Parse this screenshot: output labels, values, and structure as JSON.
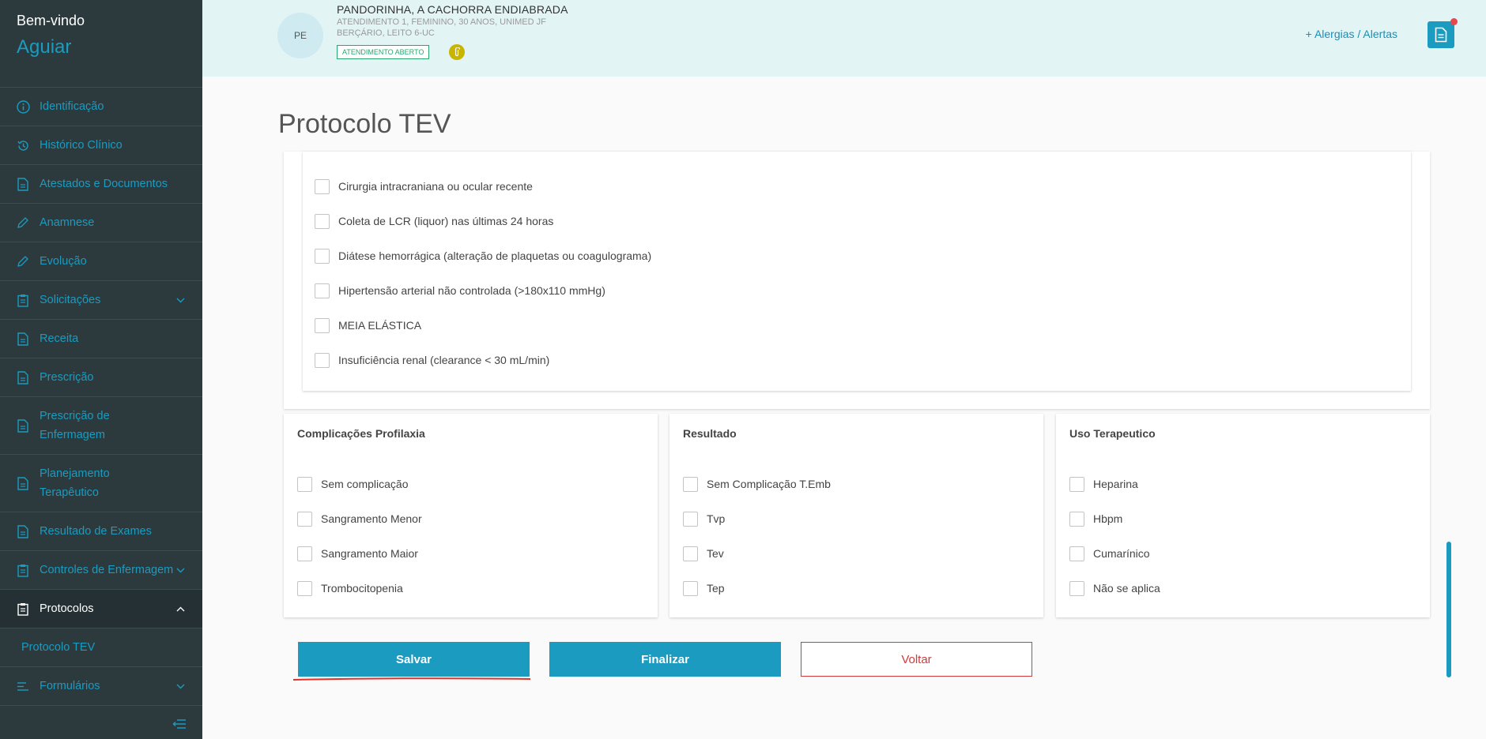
{
  "sidebar": {
    "welcome": "Bem-vindo",
    "user": "Aguiar",
    "items": [
      {
        "label": "Identificação",
        "icon": "info-icon"
      },
      {
        "label": "Histórico Clínico",
        "icon": "history-icon"
      },
      {
        "label": "Atestados e Documentos",
        "icon": "document-icon"
      },
      {
        "label": "Anamnese",
        "icon": "pencil-icon"
      },
      {
        "label": "Evolução",
        "icon": "pencil-icon"
      },
      {
        "label": "Solicitações",
        "icon": "clipboard-icon"
      },
      {
        "label": "Receita",
        "icon": "document-icon"
      },
      {
        "label": "Prescrição",
        "icon": "document-icon"
      },
      {
        "label": "Prescrição de Enfermagem",
        "icon": "document-icon"
      },
      {
        "label": "Planejamento Terapêutico",
        "icon": "document-icon"
      },
      {
        "label": "Resultado de Exames",
        "icon": "document-icon"
      },
      {
        "label": "Controles de Enfermagem",
        "icon": "clipboard-icon"
      },
      {
        "label": "Protocolos",
        "icon": "clipboard-icon"
      },
      {
        "label": "Formulários",
        "icon": "list-icon"
      }
    ],
    "subitem": "Protocolo TEV"
  },
  "header": {
    "initials": "PE",
    "patient_name": "PANDORINHA, A CACHORRA ENDIABRADA",
    "line1": "ATENDIMENTO 1, FEMININO, 30 ANOS, UNIMED JF",
    "line2": "BERÇÁRIO, LEITO 6-UC",
    "status_badge": "ATENDIMENTO ABERTO",
    "allergies": "+  Alergias / Alertas"
  },
  "main": {
    "title": "Protocolo TEV",
    "contraindications": [
      "Cirurgia intracraniana ou ocular recente",
      "Coleta de LCR (liquor) nas últimas 24 horas",
      "Diátese hemorrágica (alteração de plaquetas ou coagulograma)",
      "Hipertensão arterial não controlada (>180x110 mmHg)",
      "MEIA ELÁSTICA",
      "Insuficiência renal (clearance < 30 mL/min)"
    ],
    "cards": [
      {
        "title": "Complicações Profilaxia",
        "options": [
          "Sem complicação",
          "Sangramento Menor",
          "Sangramento Maior",
          "Trombocitopenia"
        ]
      },
      {
        "title": "Resultado",
        "options": [
          "Sem Complicação T.Emb",
          "Tvp",
          "Tev",
          "Tep"
        ]
      },
      {
        "title": "Uso Terapeutico",
        "options": [
          "Heparina",
          "Hbpm",
          "Cumarínico",
          "Não se aplica"
        ]
      }
    ],
    "buttons": {
      "save": "Salvar",
      "finish": "Finalizar",
      "back": "Voltar"
    }
  },
  "colors": {
    "accent": "#1a9bbf",
    "sidebar_bg": "#2c3a3e",
    "danger": "#d23b3b",
    "header_bg": "#e3f4f5"
  }
}
